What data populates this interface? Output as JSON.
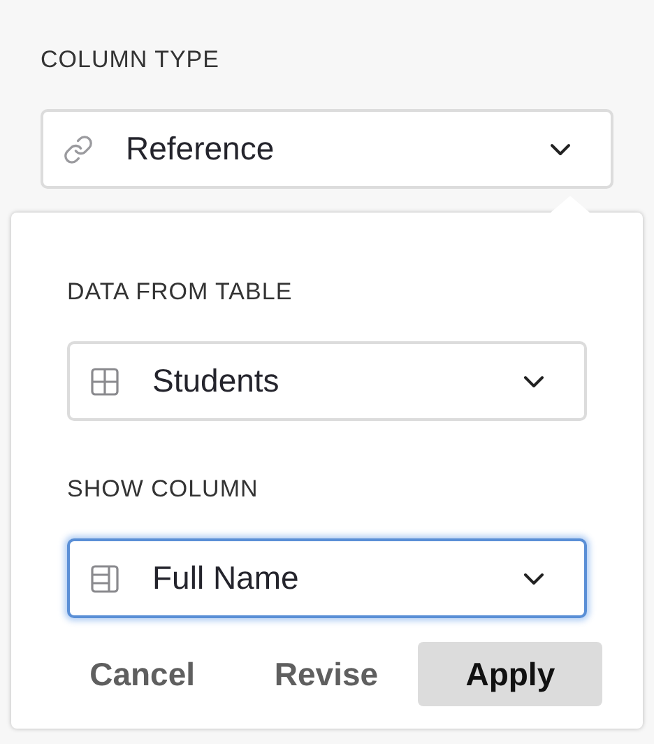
{
  "column_type": {
    "label": "COLUMN TYPE",
    "field": {
      "kind": "link",
      "value": "Reference",
      "focused": false
    }
  },
  "popover": {
    "sections": [
      {
        "label": "DATA FROM TABLE",
        "field": {
          "kind": "table",
          "value": "Students",
          "focused": false
        }
      },
      {
        "label": "SHOW COLUMN",
        "field": {
          "kind": "column",
          "value": "Full Name",
          "focused": true
        }
      }
    ],
    "buttons": [
      {
        "label": "Cancel",
        "highlighted": false
      },
      {
        "label": "Revise",
        "highlighted": false
      },
      {
        "label": "Apply",
        "highlighted": true
      }
    ]
  }
}
